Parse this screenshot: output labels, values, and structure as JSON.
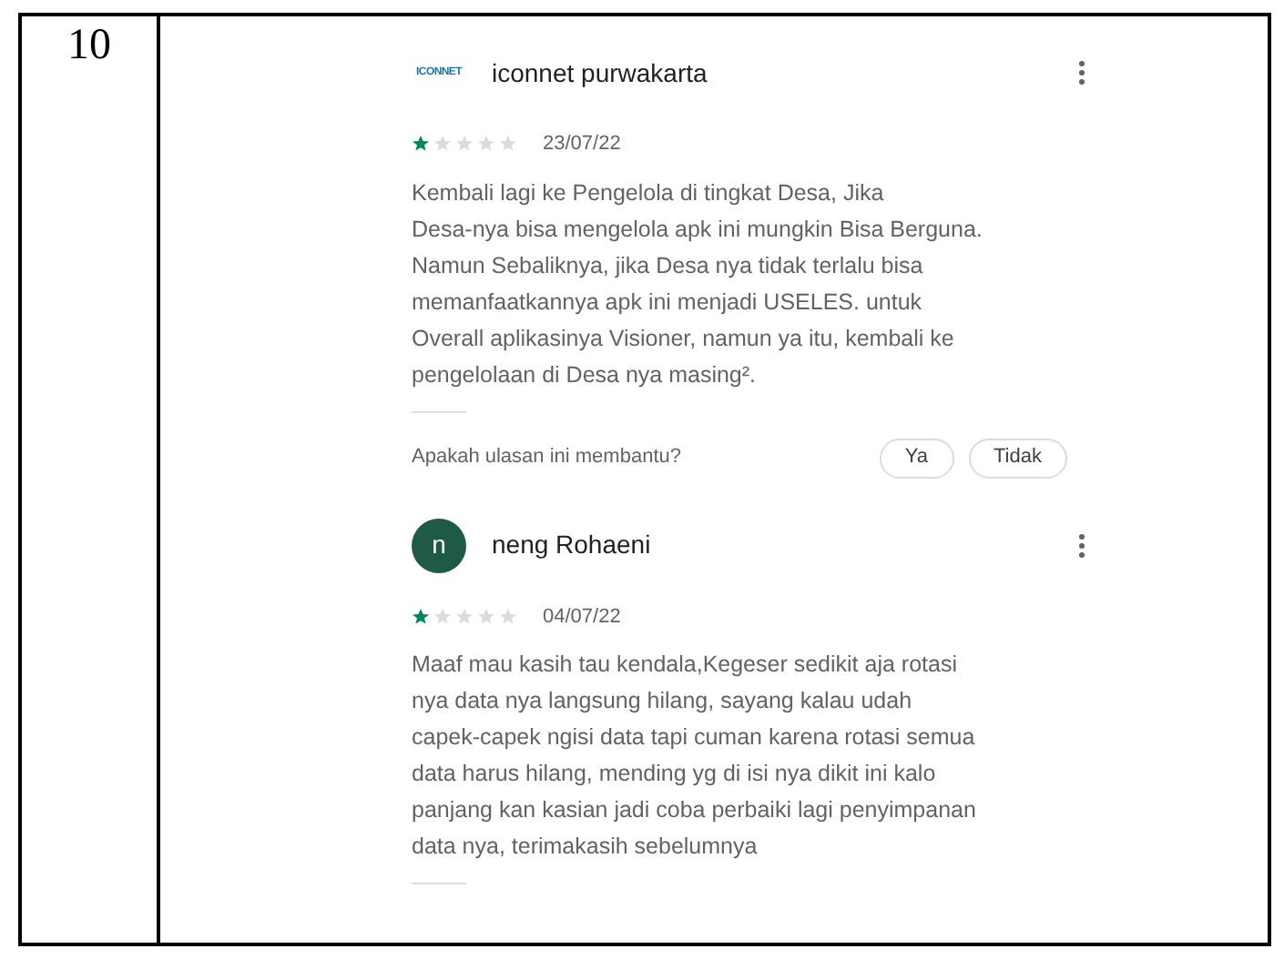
{
  "table": {
    "number": "10",
    "reviews": [
      {
        "author": "iconnet purwakarta",
        "avatar": {
          "kind": "logo",
          "text": "ICONNET"
        },
        "stars": 1,
        "date": "23/07/22",
        "text": "Kembali lagi ke Pengelola di tingkat Desa, Jika\nDesa-nya bisa mengelola apk ini mungkin Bisa Berguna.\nNamun Sebaliknya, jika Desa nya tidak terlalu bisa\nmemanfaatkannya apk ini menjadi USELES. untuk\nOverall aplikasinya Visioner, namun ya itu, kembali ke\npengelolaan di Desa nya masing².",
        "helpful": {
          "question": "Apakah ulasan ini membantu?",
          "buttons": [
            "Ya",
            "Tidak"
          ]
        }
      },
      {
        "author": "neng Rohaeni",
        "avatar": {
          "kind": "letter",
          "text": "n"
        },
        "stars": 1,
        "date": "04/07/22",
        "text": "Maaf mau kasih tau kendala,Kegeser sedikit aja rotasi\nnya data nya langsung hilang, sayang kalau udah\ncapek-capek ngisi data tapi cuman karena rotasi semua\ndata harus hilang, mending yg di isi nya dikit ini kalo\npanjang kan kasian jadi coba perbaiki lagi penyimpanan\ndata nya, terimakasih sebelumnya"
      }
    ]
  }
}
